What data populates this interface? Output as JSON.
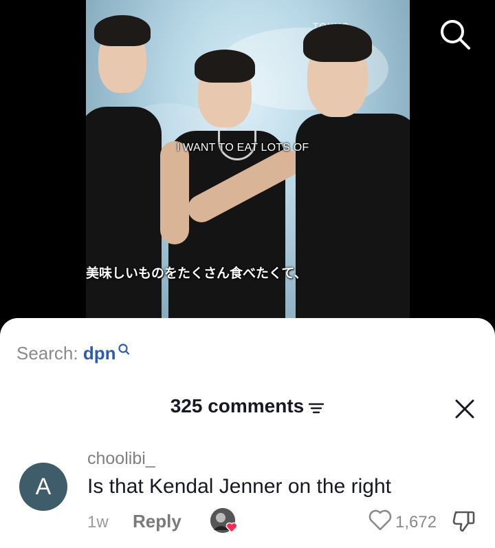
{
  "video": {
    "subtitle_en": "I WANT TO EAT LOTS OF",
    "subtitle_jp": "美味しいものをたくさん食べたくて、",
    "brand_text": "TOKYO"
  },
  "search": {
    "prefix": "Search:",
    "keyword": "dpn"
  },
  "comments_header": {
    "title": "325 comments"
  },
  "comment": {
    "avatar_letter": "A",
    "username": "choolibi_",
    "text": "Is that Kendal Jenner on the right",
    "time": "1w",
    "reply_label": "Reply",
    "like_count": "1,672"
  },
  "colors": {
    "keyword": "#2d5bb3",
    "avatar_bg": "#3e5c6a",
    "heart": "#fe2c55"
  }
}
